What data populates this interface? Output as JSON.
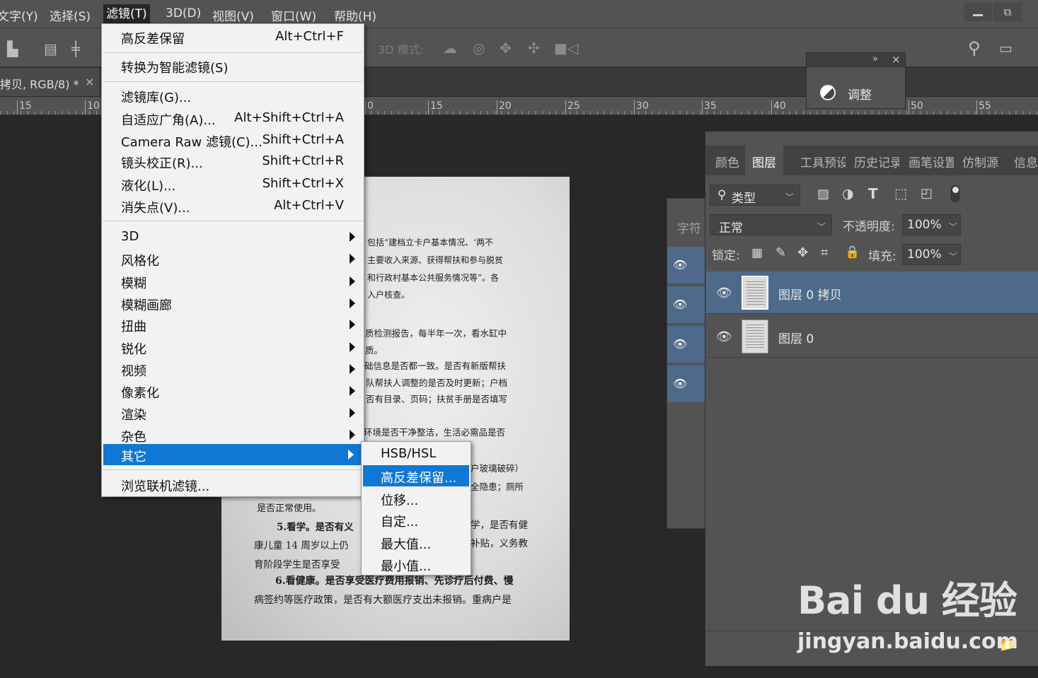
{
  "menubar": {
    "items": [
      "文字(Y)",
      "选择(S)",
      "滤镜(T)",
      "3D(D)",
      "视图(V)",
      "窗口(W)",
      "帮助(H)"
    ],
    "active_index": 2
  },
  "options_bar": {
    "mode_3d_label": "3D 模式:"
  },
  "document": {
    "tab_title": "拷贝, RGB/8) *",
    "close": "×",
    "ruler_numbers": [
      "15",
      "10",
      "0",
      "15",
      "20",
      "25",
      "30",
      "35",
      "40",
      "50",
      "55"
    ],
    "page_lines": [
      "包括“建档立卡户基本情况、‘两不",
      "主要收入来源、获得帮扶和参与脱贫",
      "和行政村基本公共服务情况等”。各",
      "入户核查。",
      "质检测报告，每半年一次，看水缸中",
      "质。",
      "础信息是否都一致。是否有新版帮扶",
      "队帮扶人调整的是否及时更新；户档",
      "否有目录、页码；扶贫手册是否填写",
      "环境是否干净整洁，生活必需品是否",
      "户玻璃破碎）",
      "全隐患；厕所",
      "是否正常使用。",
      "5.看学。是否有义",
      "学，是否有健",
      "康儿童 14 周岁以上仍",
      "补贴，义务教",
      "育阶段学生是否享受",
      "6.看健康。是否享受医疗费用报销、先诊疗后付费、慢",
      "病签约等医疗政策，是否有大额医疗支出未报销。重病户是"
    ]
  },
  "filter_menu": {
    "items": [
      {
        "label": "高反差保留",
        "shortcut": "Alt+Ctrl+F"
      },
      {
        "label": "转换为智能滤镜(S)",
        "shortcut": ""
      },
      {
        "label": "滤镜库(G)...",
        "shortcut": ""
      },
      {
        "label": "自适应广角(A)...",
        "shortcut": "Alt+Shift+Ctrl+A"
      },
      {
        "label": "Camera Raw 滤镜(C)...",
        "shortcut": "Shift+Ctrl+A"
      },
      {
        "label": "镜头校正(R)...",
        "shortcut": "Shift+Ctrl+R"
      },
      {
        "label": "液化(L)...",
        "shortcut": "Shift+Ctrl+X"
      },
      {
        "label": "消失点(V)...",
        "shortcut": "Alt+Ctrl+V"
      },
      {
        "label": "3D",
        "shortcut": ""
      },
      {
        "label": "风格化",
        "shortcut": ""
      },
      {
        "label": "模糊",
        "shortcut": ""
      },
      {
        "label": "模糊画廊",
        "shortcut": ""
      },
      {
        "label": "扭曲",
        "shortcut": ""
      },
      {
        "label": "锐化",
        "shortcut": ""
      },
      {
        "label": "视频",
        "shortcut": ""
      },
      {
        "label": "像素化",
        "shortcut": ""
      },
      {
        "label": "渲染",
        "shortcut": ""
      },
      {
        "label": "杂色",
        "shortcut": ""
      },
      {
        "label": "其它",
        "shortcut": ""
      },
      {
        "label": "浏览联机滤镜...",
        "shortcut": ""
      }
    ],
    "highlighted": "其它"
  },
  "other_submenu": {
    "items": [
      "HSB/HSL",
      "高反差保留...",
      "位移...",
      "自定...",
      "最大值...",
      "最小值..."
    ],
    "highlighted": "高反差保留..."
  },
  "adjust_panel": {
    "label": "调整",
    "collapse": "»",
    "close": "×"
  },
  "mini_dock": {
    "label": "字符"
  },
  "layers_panel": {
    "tabs": [
      "颜色",
      "图层",
      "工具预设",
      "历史记录",
      "画笔设置",
      "仿制源",
      "信息"
    ],
    "active_tab": "图层",
    "filter_type": "类型",
    "blend_mode": "正常",
    "opacity_label": "不透明度:",
    "opacity_value": "100%",
    "lock_label": "锁定:",
    "fill_label": "填充:",
    "fill_value": "100%",
    "layers": [
      {
        "name": "图层 0 拷贝",
        "selected": true
      },
      {
        "name": "图层 0",
        "selected": false
      }
    ]
  },
  "watermark": {
    "logo": "Bai du 经验",
    "url": "jingyan.baidu.com"
  },
  "colors": {
    "menu_highlight": "#0f78d4",
    "panel_bg": "#535353",
    "selected_layer": "#4e6a8a"
  }
}
